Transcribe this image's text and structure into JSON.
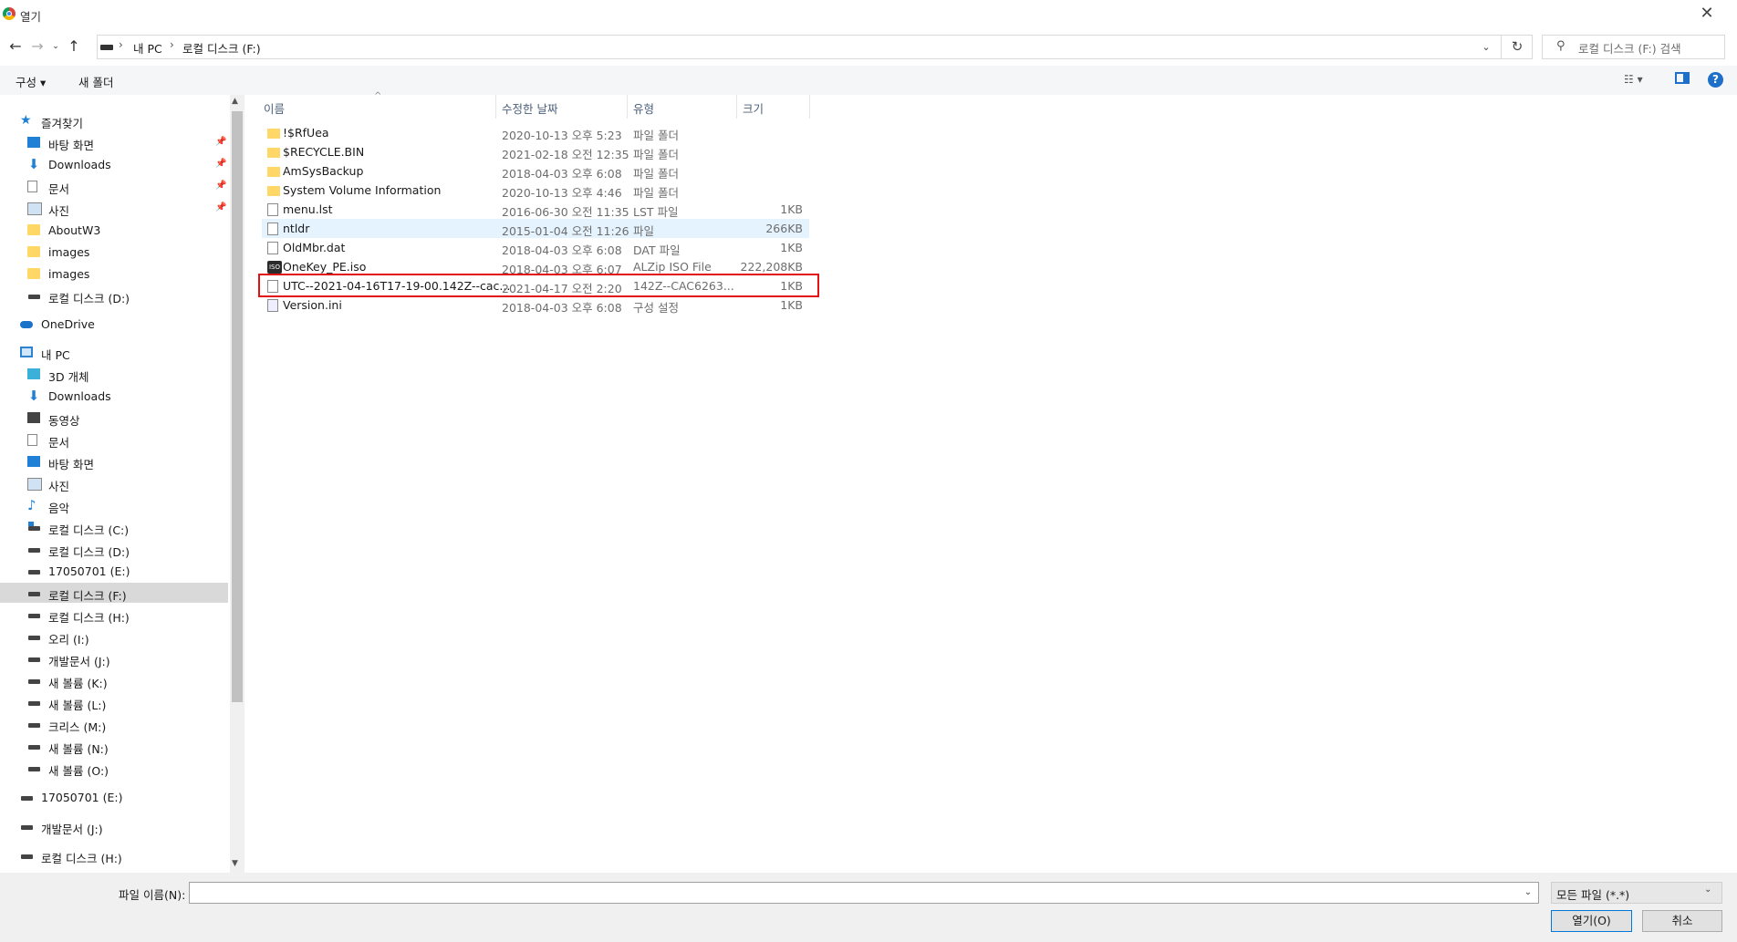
{
  "window": {
    "title": "열기"
  },
  "address": {
    "crumbs": [
      "내 PC",
      "로컬 디스크 (F:)"
    ],
    "search_placeholder": "로컬 디스크 (F:) 검색"
  },
  "toolbar": {
    "organize_label": "구성 ▾",
    "new_folder_label": "새 폴더"
  },
  "nav": {
    "items": [
      {
        "label": "즐겨찾기",
        "icon": "star-icon"
      },
      {
        "label": "바탕 화면",
        "icon": "desktop-icon",
        "pinned": true
      },
      {
        "label": "Downloads",
        "icon": "download-icon",
        "pinned": true
      },
      {
        "label": "문서",
        "icon": "document-icon",
        "pinned": true
      },
      {
        "label": "사진",
        "icon": "picture-icon",
        "pinned": true
      },
      {
        "label": "AboutW3",
        "icon": "folder-icon"
      },
      {
        "label": "images",
        "icon": "folder-icon"
      },
      {
        "label": "images",
        "icon": "folder-icon"
      },
      {
        "label": "로컬 디스크 (D:)",
        "icon": "drive-icon"
      },
      {
        "label": "OneDrive",
        "icon": "cloud-icon"
      },
      {
        "label": "내 PC",
        "icon": "pc-icon"
      },
      {
        "label": "3D 개체",
        "icon": "3d-objects-icon"
      },
      {
        "label": "Downloads",
        "icon": "download-icon"
      },
      {
        "label": "동영상",
        "icon": "video-icon"
      },
      {
        "label": "문서",
        "icon": "document-icon"
      },
      {
        "label": "바탕 화면",
        "icon": "desktop-icon"
      },
      {
        "label": "사진",
        "icon": "picture-icon"
      },
      {
        "label": "음악",
        "icon": "music-icon"
      },
      {
        "label": "로컬 디스크 (C:)",
        "icon": "windows-drive-icon"
      },
      {
        "label": "로컬 디스크 (D:)",
        "icon": "drive-icon"
      },
      {
        "label": "17050701 (E:)",
        "icon": "drive-icon"
      },
      {
        "label": "로컬 디스크 (F:)",
        "icon": "drive-icon",
        "selected": true
      },
      {
        "label": "로컬 디스크 (H:)",
        "icon": "drive-icon"
      },
      {
        "label": "오리 (I:)",
        "icon": "drive-icon"
      },
      {
        "label": "개발문서 (J:)",
        "icon": "drive-icon"
      },
      {
        "label": "새 볼륨 (K:)",
        "icon": "drive-icon"
      },
      {
        "label": "새 볼륨 (L:)",
        "icon": "drive-icon"
      },
      {
        "label": "크리스 (M:)",
        "icon": "drive-icon"
      },
      {
        "label": "새 볼륨 (N:)",
        "icon": "drive-icon"
      },
      {
        "label": "새 볼륨 (O:)",
        "icon": "drive-icon"
      },
      {
        "label": "17050701 (E:)",
        "icon": "drive-icon"
      },
      {
        "label": "개발문서 (J:)",
        "icon": "drive-icon"
      },
      {
        "label": "로컬 디스크 (H:)",
        "icon": "drive-icon"
      }
    ]
  },
  "columns": {
    "name": "이름",
    "date": "수정한 날짜",
    "type": "유형",
    "size": "크기"
  },
  "files": [
    {
      "name": "!$RfUea",
      "date": "2020-10-13 오후 5:23",
      "type": "파일 폴더",
      "size": "",
      "icon": "folder-icon"
    },
    {
      "name": "$RECYCLE.BIN",
      "date": "2021-02-18 오전 12:35",
      "type": "파일 폴더",
      "size": "",
      "icon": "folder-icon"
    },
    {
      "name": "AmSysBackup",
      "date": "2018-04-03 오후 6:08",
      "type": "파일 폴더",
      "size": "",
      "icon": "folder-icon"
    },
    {
      "name": "System Volume Information",
      "date": "2020-10-13 오후 4:46",
      "type": "파일 폴더",
      "size": "",
      "icon": "folder-icon"
    },
    {
      "name": "menu.lst",
      "date": "2016-06-30 오전 11:35",
      "type": "LST 파일",
      "size": "1KB",
      "icon": "file-icon"
    },
    {
      "name": "ntldr",
      "date": "2015-01-04 오전 11:26",
      "type": "파일",
      "size": "266KB",
      "icon": "file-icon"
    },
    {
      "name": "OldMbr.dat",
      "date": "2018-04-03 오후 6:08",
      "type": "DAT 파일",
      "size": "1KB",
      "icon": "file-icon"
    },
    {
      "name": "OneKey_PE.iso",
      "date": "2018-04-03 오후 6:07",
      "type": "ALZip ISO File",
      "size": "222,208KB",
      "icon": "iso-icon"
    },
    {
      "name": "UTC--2021-04-16T17-19-00.142Z--cac...",
      "date": "2021-04-17 오전 2:20",
      "type": "142Z--CAC6263...",
      "size": "1KB",
      "icon": "file-icon"
    },
    {
      "name": "Version.ini",
      "date": "2018-04-03 오후 6:08",
      "type": "구성 설정",
      "size": "1KB",
      "icon": "settings-file-icon"
    }
  ],
  "bottom": {
    "filename_label": "파일 이름(N):",
    "filename_value": "",
    "filter_label": "모든 파일 (*.*)",
    "open_label": "열기(O)",
    "cancel_label": "취소"
  }
}
